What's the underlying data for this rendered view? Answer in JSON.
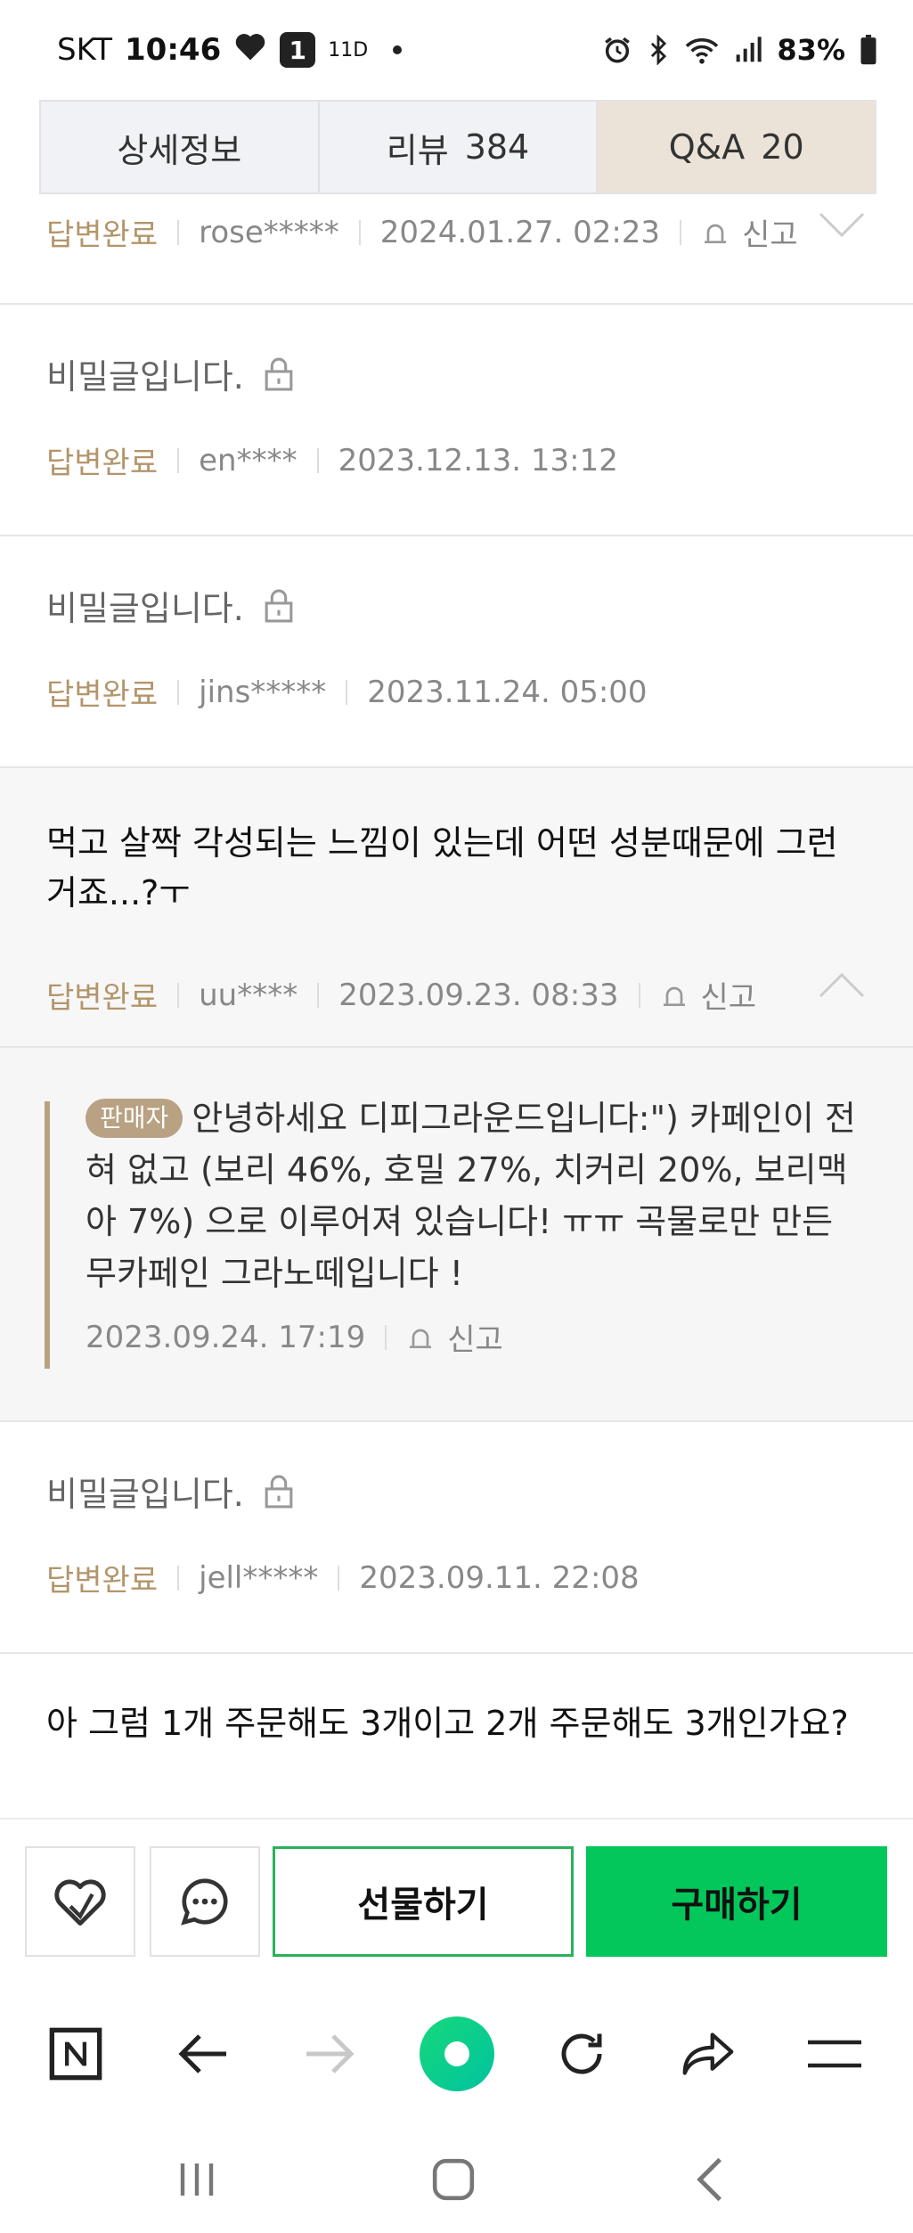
{
  "status_bar": {
    "carrier": "SKT",
    "time": "10:46",
    "badge": "1",
    "small_label": "11D",
    "battery": "83%"
  },
  "tabs": [
    {
      "label": "상세정보",
      "count": ""
    },
    {
      "label": "리뷰",
      "count": "384"
    },
    {
      "label": "Q&A",
      "count": "20"
    }
  ],
  "qa": {
    "top_partial": {
      "status": "답변완료",
      "user": "rose*****",
      "date": "2024.01.27. 02:23",
      "report": "신고"
    },
    "item1": {
      "secret": "비밀글입니다.",
      "status": "답변완료",
      "user": "en****",
      "date": "2023.12.13. 13:12"
    },
    "item2": {
      "secret": "비밀글입니다.",
      "status": "답변완료",
      "user": "jins*****",
      "date": "2023.11.24. 05:00"
    },
    "item3": {
      "question": "먹고 살짝 각성되는 느낌이 있는데 어떤 성분때문에 그런 거죠...?ㅜ",
      "status": "답변완료",
      "user": "uu****",
      "date": "2023.09.23. 08:33",
      "report": "신고",
      "answer": {
        "badge": "판매자",
        "text": "안녕하세요 디피그라운드입니다:\") 카페인이 전혀 없고 (보리 46%, 호밀 27%, 치커리 20%, 보리맥아 7%) 으로 이루어져 있습니다! ㅠㅠ 곡물로만 만든 무카페인 그라노떼입니다 !",
        "date": "2023.09.24. 17:19",
        "report": "신고"
      }
    },
    "item4": {
      "secret": "비밀글입니다.",
      "status": "답변완료",
      "user": "jell*****",
      "date": "2023.09.11. 22:08"
    },
    "item5": {
      "question": "아 그럼 1개 주문해도 3개이고 2개 주문해도 3개인가요?"
    }
  },
  "actions": {
    "gift": "선물하기",
    "buy": "구매하기"
  },
  "browser": {
    "naver_label": "N"
  },
  "colors": {
    "accent_green": "#03c75a",
    "status_gold": "#b3956b",
    "tab_active": "#ebe3d8"
  }
}
